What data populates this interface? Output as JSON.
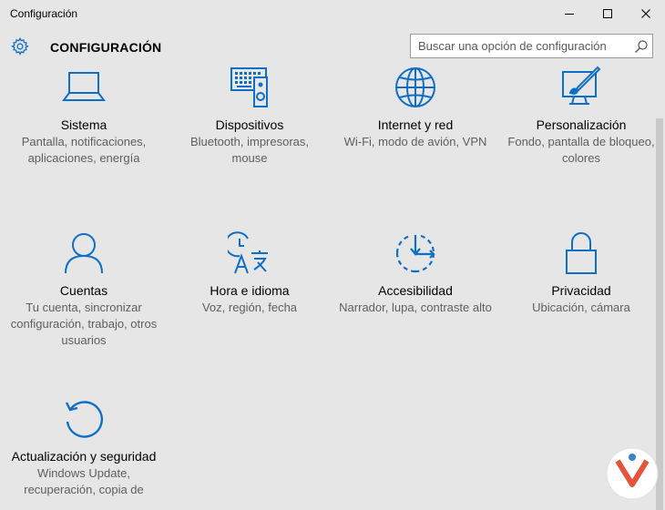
{
  "window": {
    "title": "Configuración"
  },
  "header": {
    "title": "CONFIGURACIÓN",
    "search_placeholder": "Buscar una opción de configuración"
  },
  "tiles": [
    {
      "icon": "laptop-icon",
      "name": "Sistema",
      "desc": "Pantalla, notificaciones, aplicaciones, energía"
    },
    {
      "icon": "devices-icon",
      "name": "Dispositivos",
      "desc": "Bluetooth, impresoras, mouse"
    },
    {
      "icon": "globe-icon",
      "name": "Internet y red",
      "desc": "Wi-Fi, modo de avión, VPN"
    },
    {
      "icon": "personalization-icon",
      "name": "Personalización",
      "desc": "Fondo, pantalla de bloqueo, colores"
    },
    {
      "icon": "person-icon",
      "name": "Cuentas",
      "desc": "Tu cuenta, sincronizar configuración, trabajo, otros usuarios"
    },
    {
      "icon": "time-language-icon",
      "name": "Hora e idioma",
      "desc": "Voz, región, fecha"
    },
    {
      "icon": "accessibility-icon",
      "name": "Accesibilidad",
      "desc": "Narrador, lupa, contraste alto"
    },
    {
      "icon": "lock-icon",
      "name": "Privacidad",
      "desc": "Ubicación, cámara"
    },
    {
      "icon": "update-icon",
      "name": "Actualización y seguridad",
      "desc": "Windows Update, recuperación, copia de"
    }
  ],
  "colors": {
    "accent": "#0f6ec6",
    "background": "#e6e6e6"
  }
}
